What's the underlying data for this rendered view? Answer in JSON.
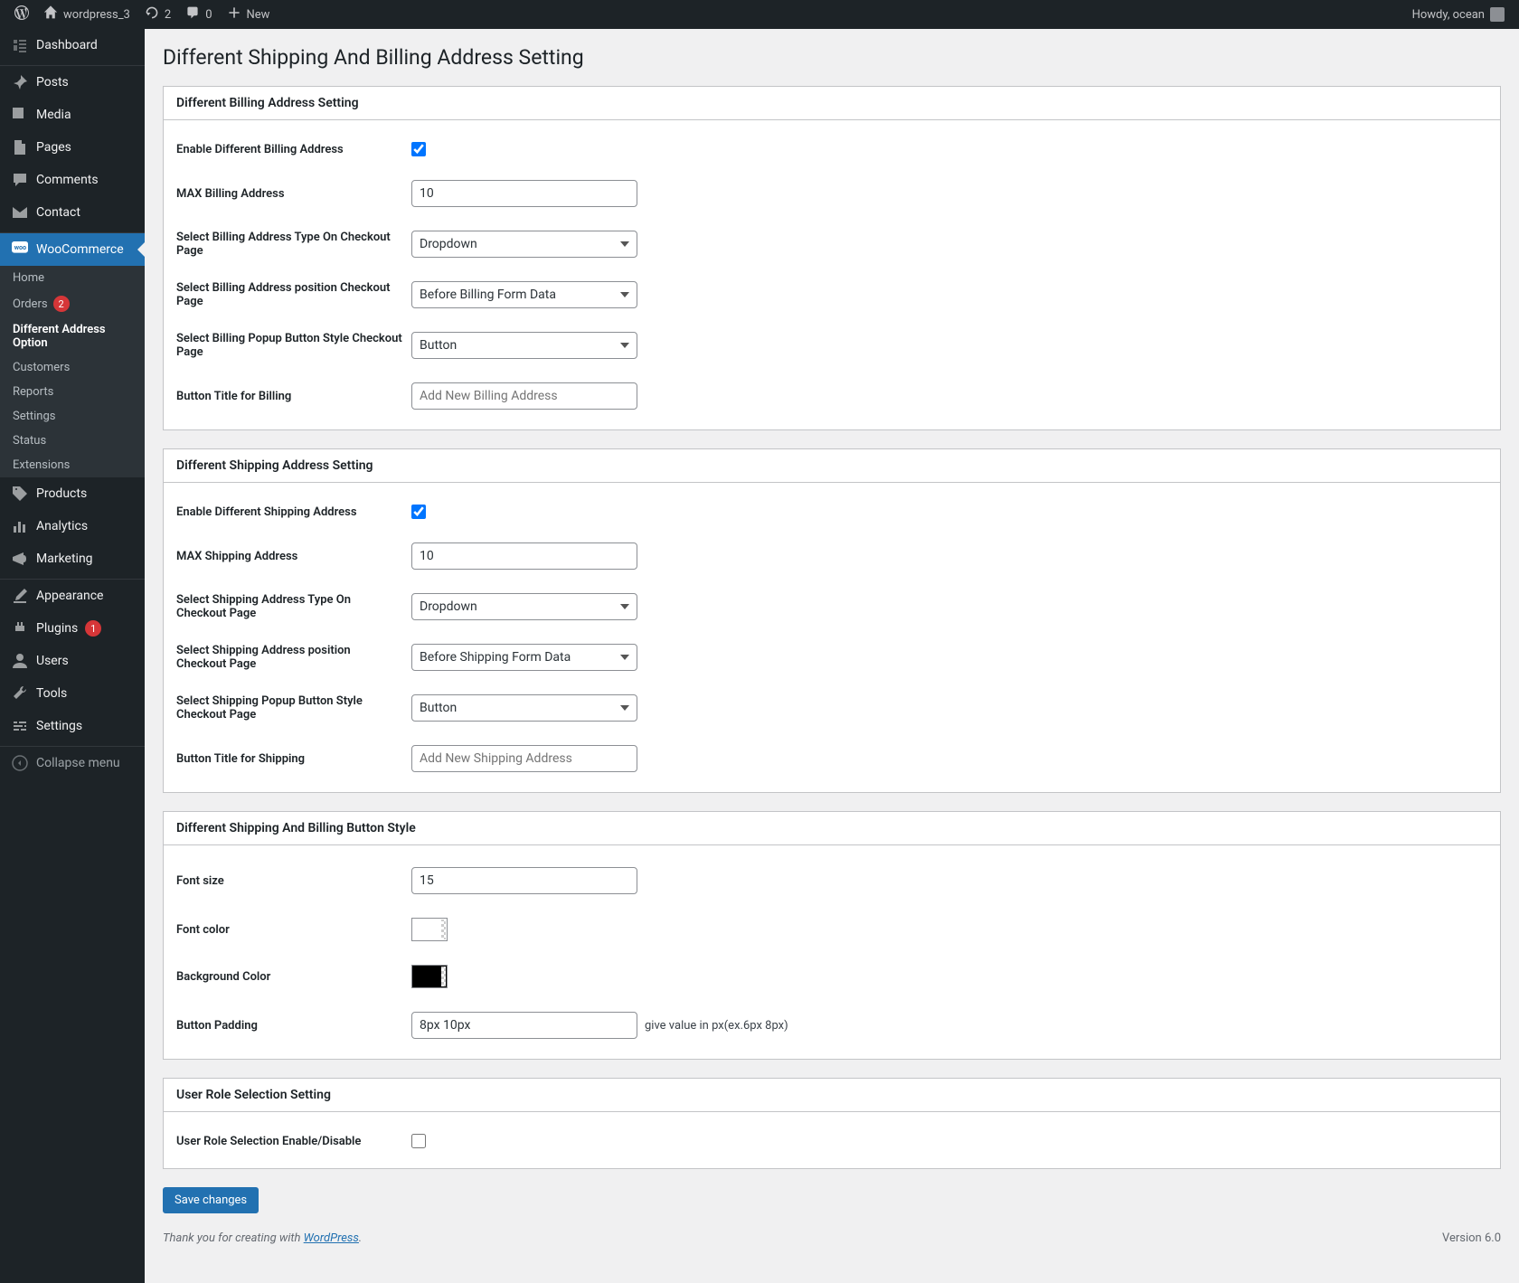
{
  "adminbar": {
    "site_name": "wordpress_3",
    "updates_count": "2",
    "comments_count": "0",
    "new_label": "New",
    "howdy_prefix": "Howdy, ",
    "user": "ocean"
  },
  "sidenav": {
    "dashboard": "Dashboard",
    "posts": "Posts",
    "media": "Media",
    "pages": "Pages",
    "comments": "Comments",
    "contact": "Contact",
    "woocommerce": "WooCommerce",
    "wc_sub": {
      "home": "Home",
      "orders": "Orders",
      "orders_badge": "2",
      "diff_addr": "Different Address Option",
      "customers": "Customers",
      "reports": "Reports",
      "settings": "Settings",
      "status": "Status",
      "extensions": "Extensions"
    },
    "products": "Products",
    "analytics": "Analytics",
    "marketing": "Marketing",
    "appearance": "Appearance",
    "plugins": "Plugins",
    "plugins_badge": "1",
    "users": "Users",
    "tools": "Tools",
    "settings": "Settings",
    "collapse": "Collapse menu"
  },
  "page": {
    "title": "Different Shipping And Billing Address Setting"
  },
  "billing": {
    "section_title": "Different Billing Address Setting",
    "enable_label": "Enable Different Billing Address",
    "enable_checked": true,
    "max_label": "MAX Billing Address",
    "max_value": "10",
    "type_label": "Select Billing Address Type On Checkout Page",
    "type_value": "Dropdown",
    "pos_label": "Select Billing Address position Checkout Page",
    "pos_value": "Before Billing Form Data",
    "popup_label": "Select Billing Popup Button Style Checkout Page",
    "popup_value": "Button",
    "btn_title_label": "Button Title for Billing",
    "btn_title_placeholder": "Add New Billing Address"
  },
  "shipping": {
    "section_title": "Different Shipping Address Setting",
    "enable_label": "Enable Different Shipping Address",
    "enable_checked": true,
    "max_label": "MAX Shipping Address",
    "max_value": "10",
    "type_label": "Select Shipping Address Type On Checkout Page",
    "type_value": "Dropdown",
    "pos_label": "Select Shipping Address position Checkout Page",
    "pos_value": "Before Shipping Form Data",
    "popup_label": "Select Shipping Popup Button Style Checkout Page",
    "popup_value": "Button",
    "btn_title_label": "Button Title for Shipping",
    "btn_title_placeholder": "Add New Shipping Address"
  },
  "style": {
    "section_title": "Different Shipping And Billing Button Style",
    "font_size_label": "Font size",
    "font_size_value": "15",
    "font_color_label": "Font color",
    "font_color_value": "#ffffff",
    "bg_color_label": "Background Color",
    "bg_color_value": "#000000",
    "padding_label": "Button Padding",
    "padding_value": "8px 10px",
    "padding_hint": "give value in px(ex.6px 8px)"
  },
  "role": {
    "section_title": "User Role Selection Setting",
    "enable_label": "User Role Selection Enable/Disable",
    "enable_checked": false
  },
  "actions": {
    "save_label": "Save changes"
  },
  "footer": {
    "thank_prefix": "Thank you for creating with ",
    "wp_link": "WordPress",
    "thank_suffix": ".",
    "version": "Version 6.0"
  }
}
